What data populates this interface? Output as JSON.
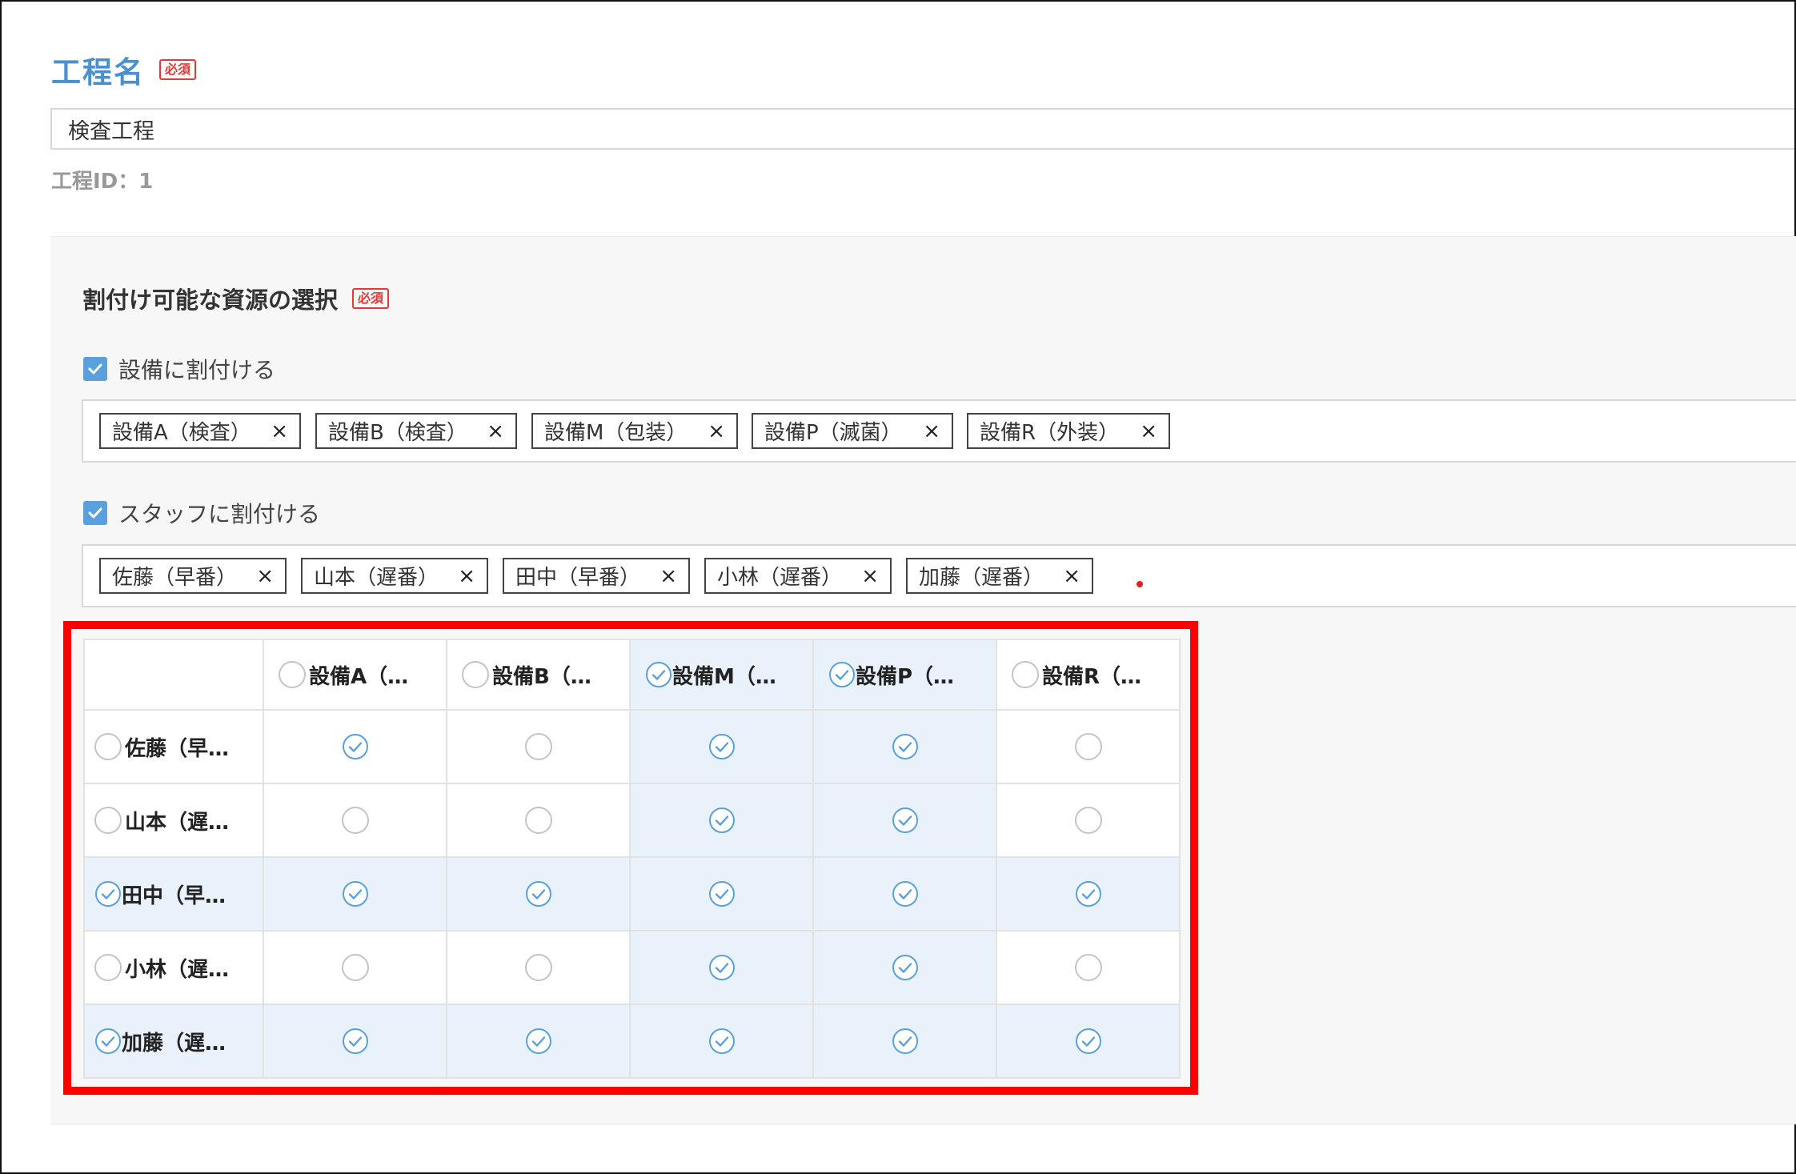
{
  "process": {
    "name_label": "工程名",
    "required_badge": "必須",
    "name_value": "検査工程",
    "id_text": "工程ID：1"
  },
  "resources": {
    "section_title": "割付け可能な資源の選択",
    "required_badge": "必須",
    "equipment_checkbox_label": "設備に割付ける",
    "staff_checkbox_label": "スタッフに割付ける",
    "equipment_tags": [
      "設備A（検査）",
      "設備B（検査）",
      "設備M（包装）",
      "設備P（滅菌）",
      "設備R（外装）"
    ],
    "staff_tags": [
      "佐藤（早番）",
      "山本（遅番）",
      "田中（早番）",
      "小林（遅番）",
      "加藤（遅番）"
    ],
    "tag_remove_symbol": "×"
  },
  "matrix": {
    "columns": [
      {
        "label": "設備A（…",
        "selected": false
      },
      {
        "label": "設備B（…",
        "selected": false
      },
      {
        "label": "設備M（…",
        "selected": true
      },
      {
        "label": "設備P（…",
        "selected": true
      },
      {
        "label": "設備R（…",
        "selected": false
      }
    ],
    "rows": [
      {
        "label": "佐藤（早…",
        "selected": false,
        "cells": [
          true,
          false,
          true,
          true,
          false
        ]
      },
      {
        "label": "山本（遅…",
        "selected": false,
        "cells": [
          false,
          false,
          true,
          true,
          false
        ]
      },
      {
        "label": "田中（早…",
        "selected": true,
        "cells": [
          true,
          true,
          true,
          true,
          true
        ]
      },
      {
        "label": "小林（遅…",
        "selected": false,
        "cells": [
          false,
          false,
          true,
          true,
          false
        ]
      },
      {
        "label": "加藤（遅…",
        "selected": true,
        "cells": [
          true,
          true,
          true,
          true,
          true
        ]
      }
    ]
  },
  "colors": {
    "accent_blue": "#5aa0de",
    "title_blue": "#4a90d0",
    "highlight_bg": "#e9f2fb",
    "required_red": "#e53935",
    "annotation_red": "#ff0000"
  },
  "icons": {
    "checked": "check-circle-icon",
    "unchecked": "empty-circle-icon",
    "checkbox": "checkbox-checked-icon"
  }
}
